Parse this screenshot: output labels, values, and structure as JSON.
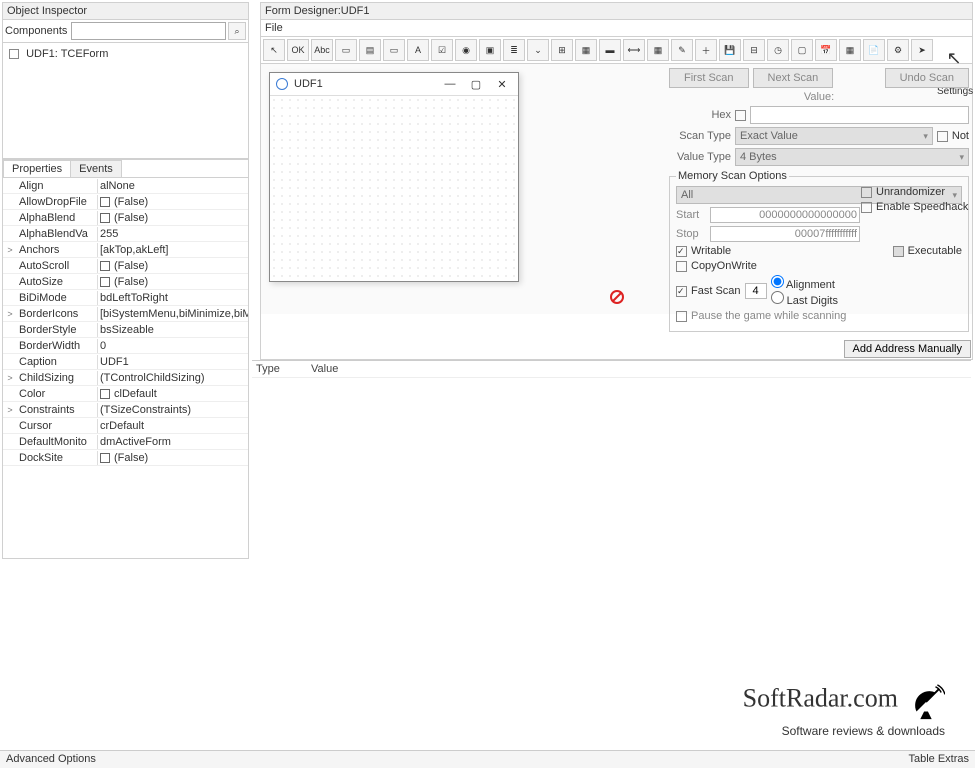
{
  "inspector": {
    "title": "Object Inspector",
    "components_label": "Components",
    "tree_item": "UDF1: TCEForm"
  },
  "tabs": {
    "properties": "Properties",
    "events": "Events"
  },
  "props": [
    {
      "exp": "",
      "key": "Align",
      "cb": false,
      "val": "alNone"
    },
    {
      "exp": "",
      "key": "AllowDropFile",
      "cb": true,
      "val": "(False)"
    },
    {
      "exp": "",
      "key": "AlphaBlend",
      "cb": true,
      "val": "(False)"
    },
    {
      "exp": "",
      "key": "AlphaBlendVa",
      "cb": false,
      "val": "255"
    },
    {
      "exp": ">",
      "key": "Anchors",
      "cb": false,
      "val": "[akTop,akLeft]"
    },
    {
      "exp": "",
      "key": "AutoScroll",
      "cb": true,
      "val": "(False)"
    },
    {
      "exp": "",
      "key": "AutoSize",
      "cb": true,
      "val": "(False)"
    },
    {
      "exp": "",
      "key": "BiDiMode",
      "cb": false,
      "val": "bdLeftToRight"
    },
    {
      "exp": ">",
      "key": "BorderIcons",
      "cb": false,
      "val": "[biSystemMenu,biMinimize,biM"
    },
    {
      "exp": "",
      "key": "BorderStyle",
      "cb": false,
      "val": "bsSizeable"
    },
    {
      "exp": "",
      "key": "BorderWidth",
      "cb": false,
      "val": "0"
    },
    {
      "exp": "",
      "key": "Caption",
      "cb": false,
      "val": "UDF1"
    },
    {
      "exp": ">",
      "key": "ChildSizing",
      "cb": false,
      "val": "(TControlChildSizing)"
    },
    {
      "exp": "",
      "key": "Color",
      "cb": true,
      "val": "clDefault"
    },
    {
      "exp": ">",
      "key": "Constraints",
      "cb": false,
      "val": "(TSizeConstraints)"
    },
    {
      "exp": "",
      "key": "Cursor",
      "cb": false,
      "val": "crDefault"
    },
    {
      "exp": "",
      "key": "DefaultMonito",
      "cb": false,
      "val": "dmActiveForm"
    },
    {
      "exp": "",
      "key": "DockSite",
      "cb": true,
      "val": "(False)"
    }
  ],
  "designer": {
    "title": "Form Designer:UDF1",
    "menu_file": "File",
    "child_title": "UDF1",
    "toolbar_icons": [
      "cursor",
      "ok",
      "abc",
      "dropdown",
      "memo",
      "panel",
      "label-a",
      "checkbox",
      "radio",
      "group",
      "list",
      "combo",
      "tabs",
      "stringgrid",
      "progress",
      "trackbar",
      "grid2",
      "pen",
      "plus",
      "save",
      "tree",
      "clock",
      "window",
      "cal",
      "table",
      "doc",
      "gear",
      "arrow"
    ]
  },
  "scan": {
    "first_scan": "First Scan",
    "next_scan": "Next Scan",
    "undo_scan": "Undo Scan",
    "settings": "Settings",
    "value_label": "Value:",
    "hex_label": "Hex",
    "not_label": "Not",
    "scan_type_label": "Scan Type",
    "scan_type_value": "Exact Value",
    "value_type_label": "Value Type",
    "value_type_value": "4 Bytes",
    "mso_title": "Memory Scan Options",
    "mso_all": "All",
    "start_label": "Start",
    "start_value": "0000000000000000",
    "stop_label": "Stop",
    "stop_value": "00007fffffffffff",
    "writable": "Writable",
    "executable": "Executable",
    "copyonwrite": "CopyOnWrite",
    "fast_scan": "Fast Scan",
    "fast_scan_val": "4",
    "alignment": "Alignment",
    "last_digits": "Last Digits",
    "pause": "Pause the game while scanning",
    "unrandomizer": "Unrandomizer",
    "speedhack": "Enable Speedhack"
  },
  "add_address": "Add Address Manually",
  "results": {
    "type": "Type",
    "value": "Value"
  },
  "watermark": {
    "main": "SoftRadar.com",
    "sub": "Software reviews & downloads"
  },
  "footer": {
    "left": "Advanced Options",
    "right": "Table Extras"
  }
}
